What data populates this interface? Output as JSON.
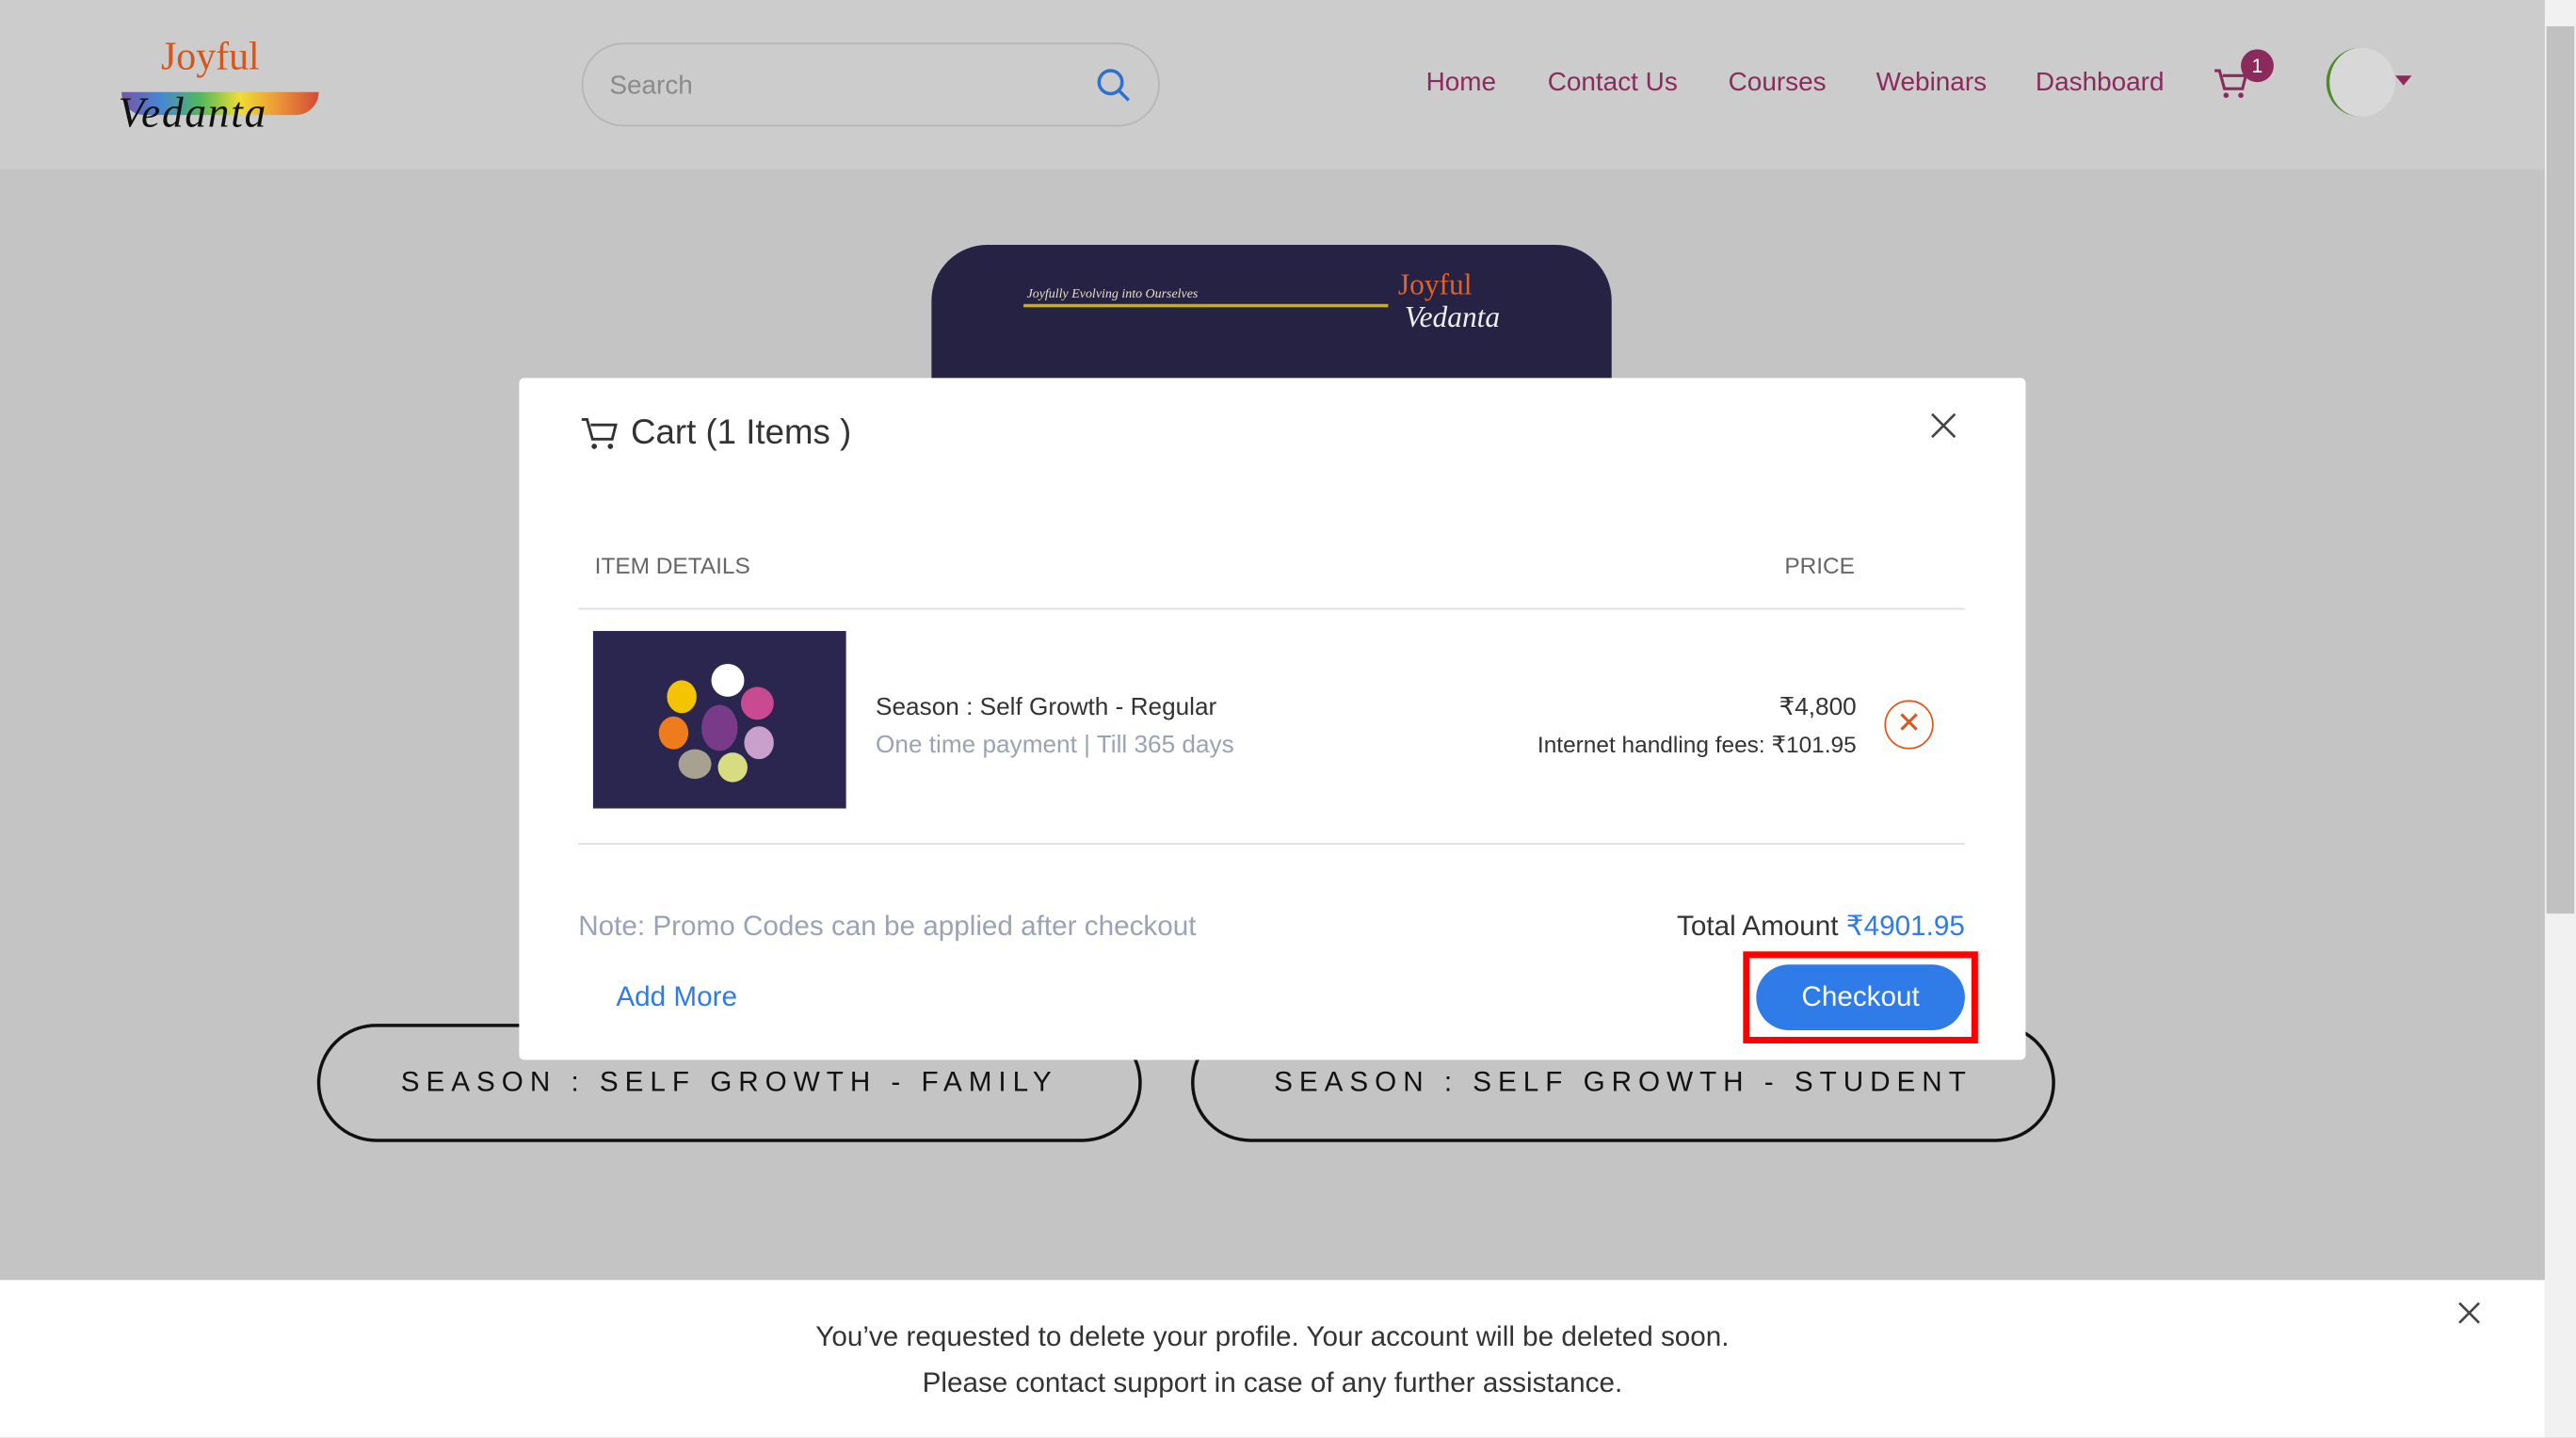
{
  "header": {
    "logo_text": "Joyful Vedanta",
    "search": {
      "placeholder": "Search",
      "value": ""
    },
    "nav": [
      "Home",
      "Contact Us",
      "Courses",
      "Webinars",
      "Dashboard"
    ],
    "cart_count": "1"
  },
  "background": {
    "banner_tagline": "Joyfully Evolving into Ourselves",
    "banner_logo_top": "Joyful",
    "banner_logo_bottom": "Vedanta",
    "pills": [
      "SEASON : SELF GROWTH - FAMILY",
      "SEASON : SELF GROWTH - STUDENT"
    ]
  },
  "cart_modal": {
    "title": "Cart (1 Items )",
    "col_item": "ITEM DETAILS",
    "col_price": "PRICE",
    "items": [
      {
        "name": "Season : Self Growth - Regular",
        "subtitle": "One time payment | Till 365 days",
        "price": "₹4,800",
        "fees": "Internet handling fees: ₹101.95"
      }
    ],
    "note": "Note: Promo Codes can be applied after checkout",
    "total_label": "Total Amount",
    "total_value": "₹4901.95",
    "add_more": "Add More",
    "checkout": "Checkout"
  },
  "toast": {
    "line1": "You’ve requested to delete your profile. Your account will be deleted soon.",
    "line2": "Please contact support in case of any further assistance."
  },
  "colors": {
    "nav": "#8b2b5d",
    "accent": "#2f7be8",
    "remove": "#e0571c",
    "highlight": "#ff0000"
  }
}
